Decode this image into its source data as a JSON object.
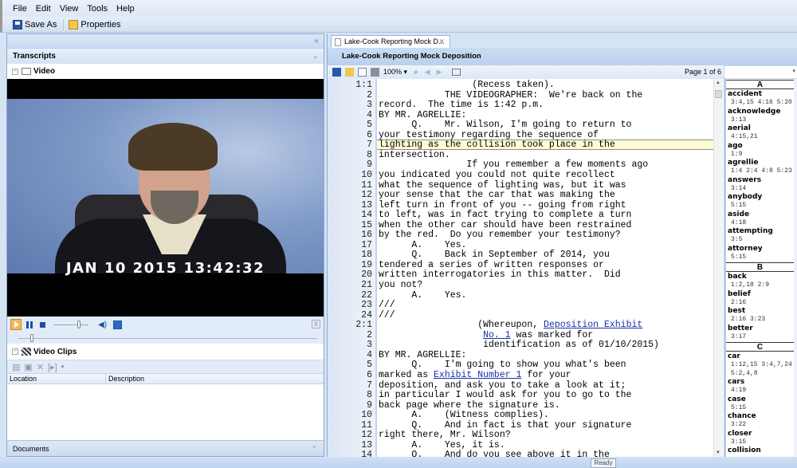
{
  "menu": [
    {
      "label": "File",
      "accel": "F"
    },
    {
      "label": "Edit",
      "accel": ""
    },
    {
      "label": "View",
      "accel": ""
    },
    {
      "label": "Tools",
      "accel": ""
    },
    {
      "label": "Help",
      "accel": "H"
    }
  ],
  "toolbar": {
    "save_as_label": "Save As",
    "properties_label": "Properties"
  },
  "left_panel": {
    "collapse_icon": "«",
    "transcripts_header": "Transcripts",
    "transcripts_chevron": "»",
    "video_node_label": "Video",
    "video_timestamp": "JAN 10 2015 13:42:32",
    "player": {
      "volume_level": 0.75,
      "seek_position": 0.04,
      "close_label": "X"
    },
    "video_clips_label": "Video Clips",
    "clips_toolbar_icons": [
      "new-clip-icon",
      "clip-properties-icon",
      "delete-icon",
      "play-clip-icon",
      "save-icon"
    ],
    "clips_columns": [
      "Location",
      "Description"
    ],
    "documents_header": "Documents",
    "documents_chevron": "«"
  },
  "document": {
    "tab_label": "Lake-Cook Reporting Mock D...",
    "tab_close": "✕",
    "title": "Lake-Cook Reporting Mock Deposition",
    "zoom": "100%",
    "page_indicator": "Page 1 of 6"
  },
  "transcript": {
    "highlighted_line_index": 6,
    "lines": [
      {
        "n": "1:1",
        "t": "                 (Recess taken)."
      },
      {
        "n": "2",
        "t": "            THE VIDEOGRAPHER:  We're back on the"
      },
      {
        "n": "3",
        "t": "record.  The time is 1:42 p.m."
      },
      {
        "n": "4",
        "t": "BY MR. AGRELLIE:"
      },
      {
        "n": "5",
        "t": "      Q.    Mr. Wilson, I'm going to return to"
      },
      {
        "n": "6",
        "t": "your testimony regarding the sequence of"
      },
      {
        "n": "7",
        "t": "lighting as the collision took place in the"
      },
      {
        "n": "8",
        "t": "intersection."
      },
      {
        "n": "9",
        "t": "                If you remember a few moments ago"
      },
      {
        "n": "10",
        "t": "you indicated you could not quite recollect"
      },
      {
        "n": "11",
        "t": "what the sequence of lighting was, but it was"
      },
      {
        "n": "12",
        "t": "your sense that the car that was making the"
      },
      {
        "n": "13",
        "t": "left turn in front of you -- going from right"
      },
      {
        "n": "14",
        "t": "to left, was in fact trying to complete a turn"
      },
      {
        "n": "15",
        "t": "when the other car should have been restrained"
      },
      {
        "n": "16",
        "t": "by the red.  Do you remember your testimony?"
      },
      {
        "n": "17",
        "t": "      A.    Yes."
      },
      {
        "n": "18",
        "t": "      Q.    Back in September of 2014, you"
      },
      {
        "n": "19",
        "t": "tendered a series of written responses or"
      },
      {
        "n": "20",
        "t": "written interrogatories in this matter.  Did"
      },
      {
        "n": "21",
        "t": "you not?"
      },
      {
        "n": "22",
        "t": "      A.    Yes."
      },
      {
        "n": "23",
        "t": "///"
      },
      {
        "n": "24",
        "t": "///"
      },
      {
        "n": "2:1",
        "t": "                  (Whereupon, ",
        "link": "Deposition Exhibit",
        "after": ""
      },
      {
        "n": "2",
        "t": "                   ",
        "link": "No. 1",
        "after": " was marked for"
      },
      {
        "n": "3",
        "t": "                   identification as of 01/10/2015)"
      },
      {
        "n": "4",
        "t": "BY MR. AGRELLIE:"
      },
      {
        "n": "5",
        "t": "      Q.    I'm going to show you what's been"
      },
      {
        "n": "6",
        "t": "marked as ",
        "link": "Exhibit Number 1",
        "after": " for your"
      },
      {
        "n": "7",
        "t": "deposition, and ask you to take a look at it;"
      },
      {
        "n": "8",
        "t": "in particular I would ask for you to go to the"
      },
      {
        "n": "9",
        "t": "back page where the signature is."
      },
      {
        "n": "10",
        "t": "      A.    (Witness complies)."
      },
      {
        "n": "11",
        "t": "      Q.    And in fact is that your signature"
      },
      {
        "n": "12",
        "t": "right there, Mr. Wilson?"
      },
      {
        "n": "13",
        "t": "      A.    Yes, it is."
      },
      {
        "n": "14",
        "t": "      Q.    And do you see above it in the"
      }
    ]
  },
  "word_index": [
    {
      "letter": "A",
      "entries": [
        {
          "word": "accident",
          "refs": [
            "3:4,15 4:16 5:20"
          ]
        },
        {
          "word": "acknowledge",
          "refs": [
            "3:13"
          ]
        },
        {
          "word": "aerial",
          "refs": [
            "4:15,21"
          ]
        },
        {
          "word": "ago",
          "refs": [
            "1:9"
          ]
        },
        {
          "word": "agrellie",
          "refs": [
            "1:4 2:4 4:8 5:23"
          ]
        },
        {
          "word": "answers",
          "refs": [
            "3:14"
          ]
        },
        {
          "word": "anybody",
          "refs": [
            "5:15"
          ]
        },
        {
          "word": "aside",
          "refs": [
            "4:18"
          ]
        },
        {
          "word": "attempting",
          "refs": [
            "3:5"
          ]
        },
        {
          "word": "attorney",
          "refs": [
            "5:15"
          ]
        }
      ]
    },
    {
      "letter": "B",
      "entries": [
        {
          "word": "back",
          "refs": [
            "1:2,18 2:9"
          ]
        },
        {
          "word": "belief",
          "refs": [
            "2:16"
          ]
        },
        {
          "word": "best",
          "refs": [
            "2:16 3:23"
          ]
        },
        {
          "word": "better",
          "refs": [
            "3:17"
          ]
        }
      ]
    },
    {
      "letter": "C",
      "entries": [
        {
          "word": "car",
          "refs": [
            "1:12,15 3:4,7,24",
            "5:2,4,8"
          ]
        },
        {
          "word": "cars",
          "refs": [
            "4:19"
          ]
        },
        {
          "word": "case",
          "refs": [
            "5:15"
          ]
        },
        {
          "word": "chance",
          "refs": [
            "3:22"
          ]
        },
        {
          "word": "closer",
          "refs": [
            "3:15"
          ]
        },
        {
          "word": "collision",
          "refs": []
        }
      ]
    }
  ],
  "status": {
    "text": "Ready"
  }
}
